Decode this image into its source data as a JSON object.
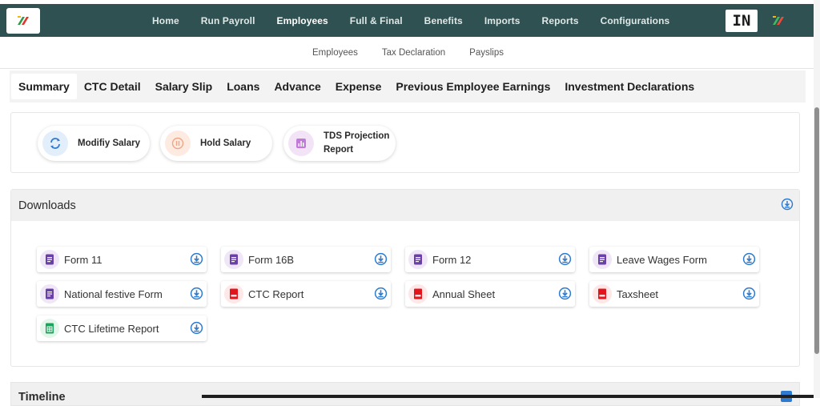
{
  "nav": {
    "items": [
      {
        "label": "Home",
        "active": false
      },
      {
        "label": "Run Payroll",
        "active": false
      },
      {
        "label": "Employees",
        "active": true
      },
      {
        "label": "Full & Final",
        "active": false
      },
      {
        "label": "Benefits",
        "active": false
      },
      {
        "label": "Imports",
        "active": false
      },
      {
        "label": "Reports",
        "active": false
      },
      {
        "label": "Configurations",
        "active": false
      }
    ],
    "badge": "IN",
    "bg_color": "#2f5152"
  },
  "subnav": {
    "items": [
      "Employees",
      "Tax Declaration",
      "Payslips"
    ]
  },
  "tabs": [
    {
      "label": "Summary",
      "active": true
    },
    {
      "label": "CTC Detail",
      "active": false
    },
    {
      "label": "Salary Slip",
      "active": false
    },
    {
      "label": "Loans",
      "active": false
    },
    {
      "label": "Advance",
      "active": false
    },
    {
      "label": "Expense",
      "active": false
    },
    {
      "label": "Previous Employee Earnings",
      "active": false
    },
    {
      "label": "Investment Declarations",
      "active": false
    }
  ],
  "actions": {
    "modify_salary": "Modifiy Salary",
    "hold_salary": "Hold Salary",
    "tds_line1": "TDS Projection",
    "tds_line2": "Report"
  },
  "downloads": {
    "title": "Downloads",
    "items": [
      {
        "label": "Form 11",
        "icon": "doc-purple-icon"
      },
      {
        "label": "Form 16B",
        "icon": "doc-purple-icon"
      },
      {
        "label": "Form 12",
        "icon": "doc-purple-icon"
      },
      {
        "label": "Leave Wages Form",
        "icon": "doc-purple-icon"
      },
      {
        "label": "National festive Form",
        "icon": "doc-purple-icon"
      },
      {
        "label": "CTC Report",
        "icon": "pdf-red-icon"
      },
      {
        "label": "Annual Sheet",
        "icon": "pdf-red-icon"
      },
      {
        "label": "Taxsheet",
        "icon": "pdf-red-icon"
      },
      {
        "label": "CTC Lifetime Report",
        "icon": "sheet-green-icon"
      }
    ]
  },
  "timeline": {
    "title": "Timeline"
  },
  "colors": {
    "accent_blue": "#2d7bd0",
    "purple": "#6b3fa8",
    "red": "#e4141c",
    "green": "#1aa35a"
  }
}
